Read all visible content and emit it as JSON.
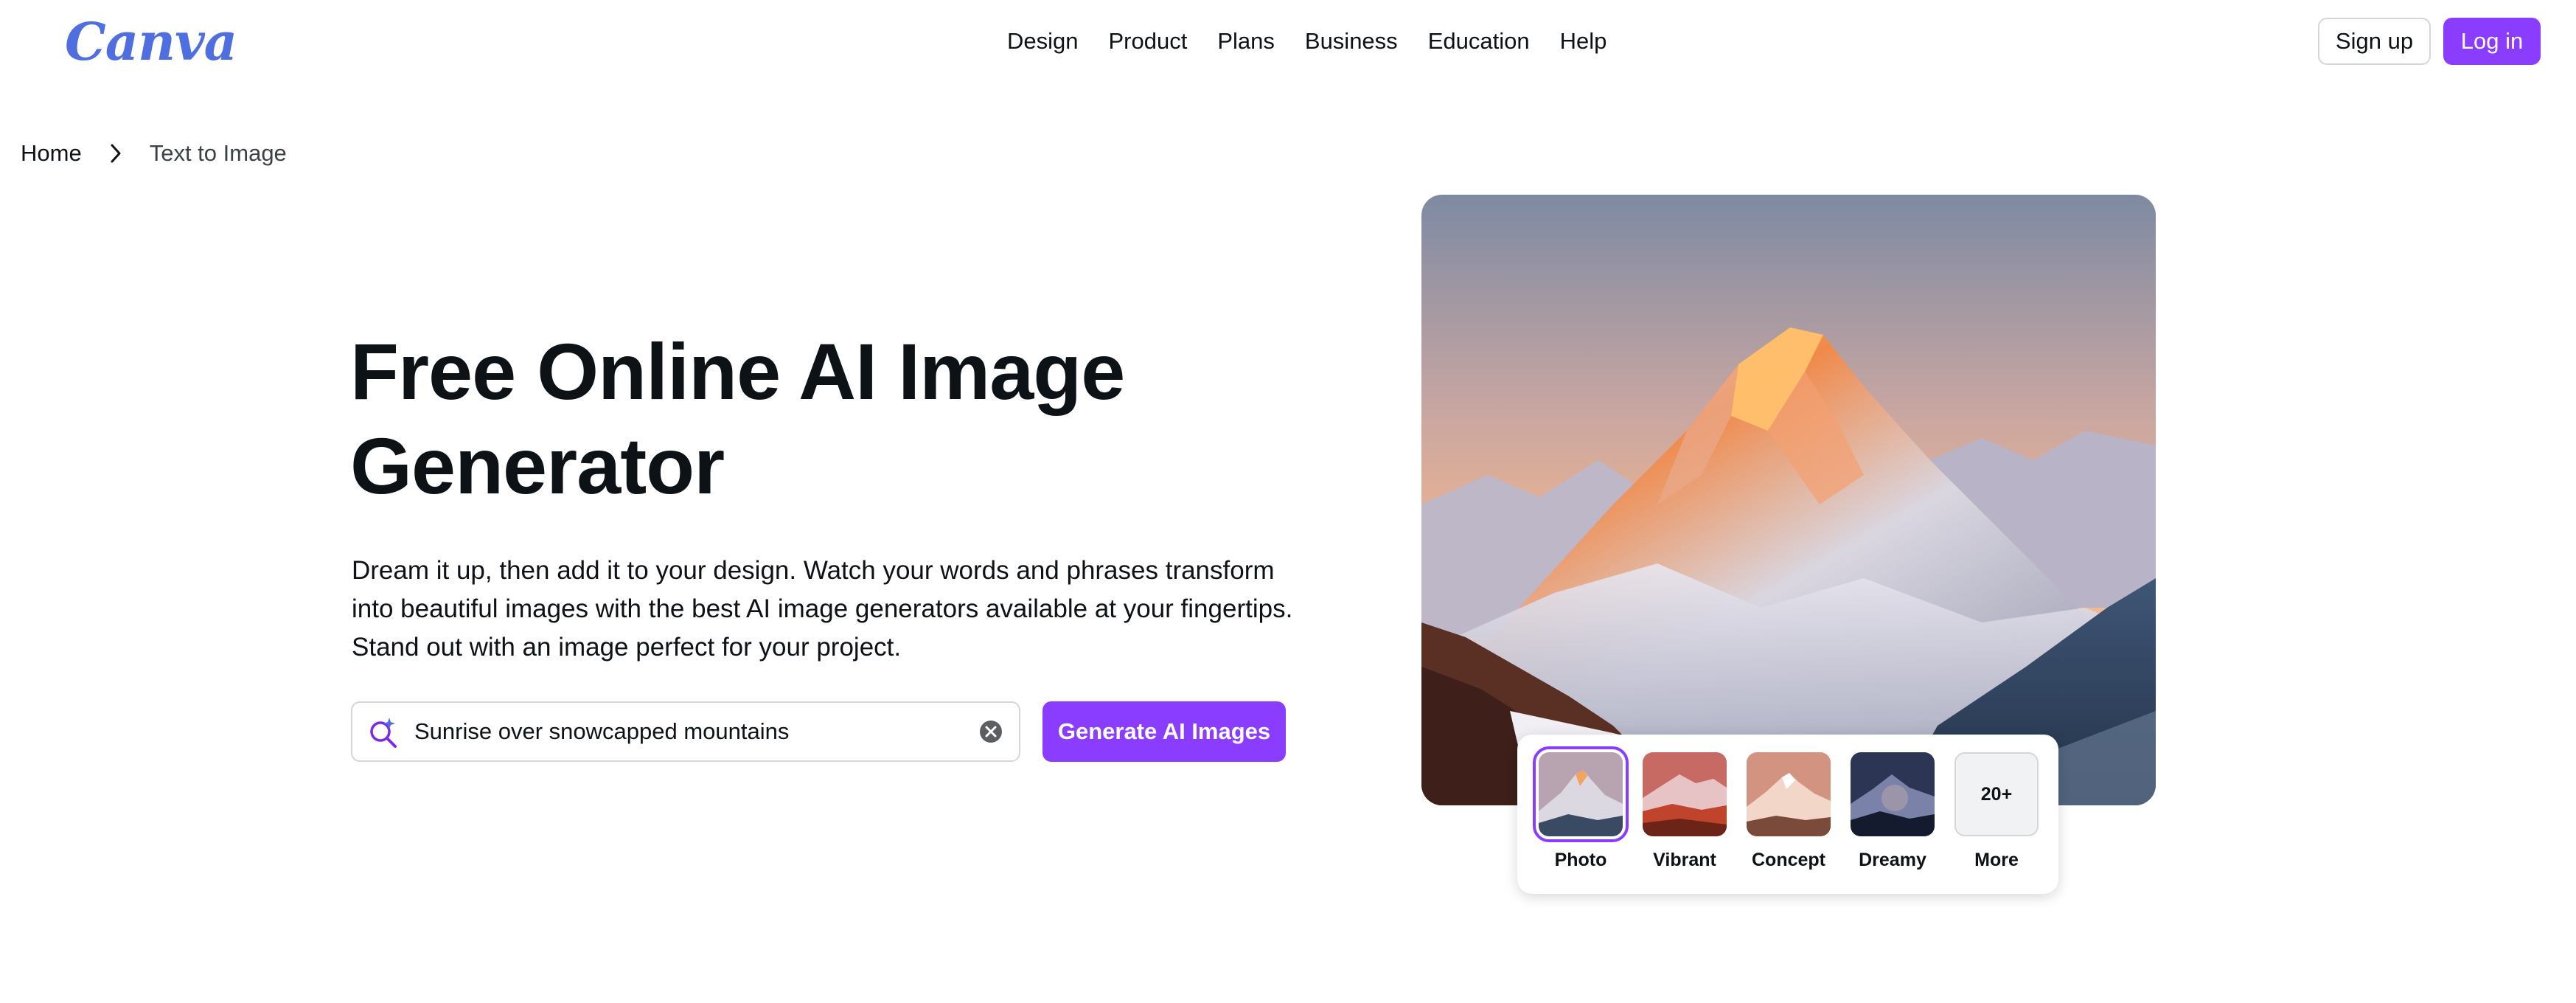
{
  "header": {
    "logo": "Canva",
    "nav": [
      "Design",
      "Product",
      "Plans",
      "Business",
      "Education",
      "Help"
    ],
    "signup_label": "Sign up",
    "login_label": "Log in"
  },
  "breadcrumb": {
    "home": "Home",
    "current": "Text to Image"
  },
  "hero": {
    "title_line1": "Free Online AI Image",
    "title_line2": "Generator",
    "description": "Dream it up, then add it to your design. Watch your words and phrases transform into beautiful images with the best AI image generators available at your fingertips. Stand out with an image perfect for your project."
  },
  "prompt": {
    "value": "Sunrise over snowcapped mountains",
    "generate_label": "Generate AI Images"
  },
  "styles": {
    "items": [
      {
        "label": "Photo",
        "selected": true
      },
      {
        "label": "Vibrant",
        "selected": false
      },
      {
        "label": "Concept",
        "selected": false
      },
      {
        "label": "Dreamy",
        "selected": false
      }
    ],
    "more_count": "20+",
    "more_label": "More"
  },
  "colors": {
    "brand_purple": "#8b3dff",
    "logo_blue": "#4f6fe0",
    "border": "#d4d6da",
    "text": "#0d1216"
  },
  "icons": {
    "breadcrumb_separator": "chevron-right-icon",
    "prompt": "magic-search-icon",
    "clear": "clear-icon"
  }
}
